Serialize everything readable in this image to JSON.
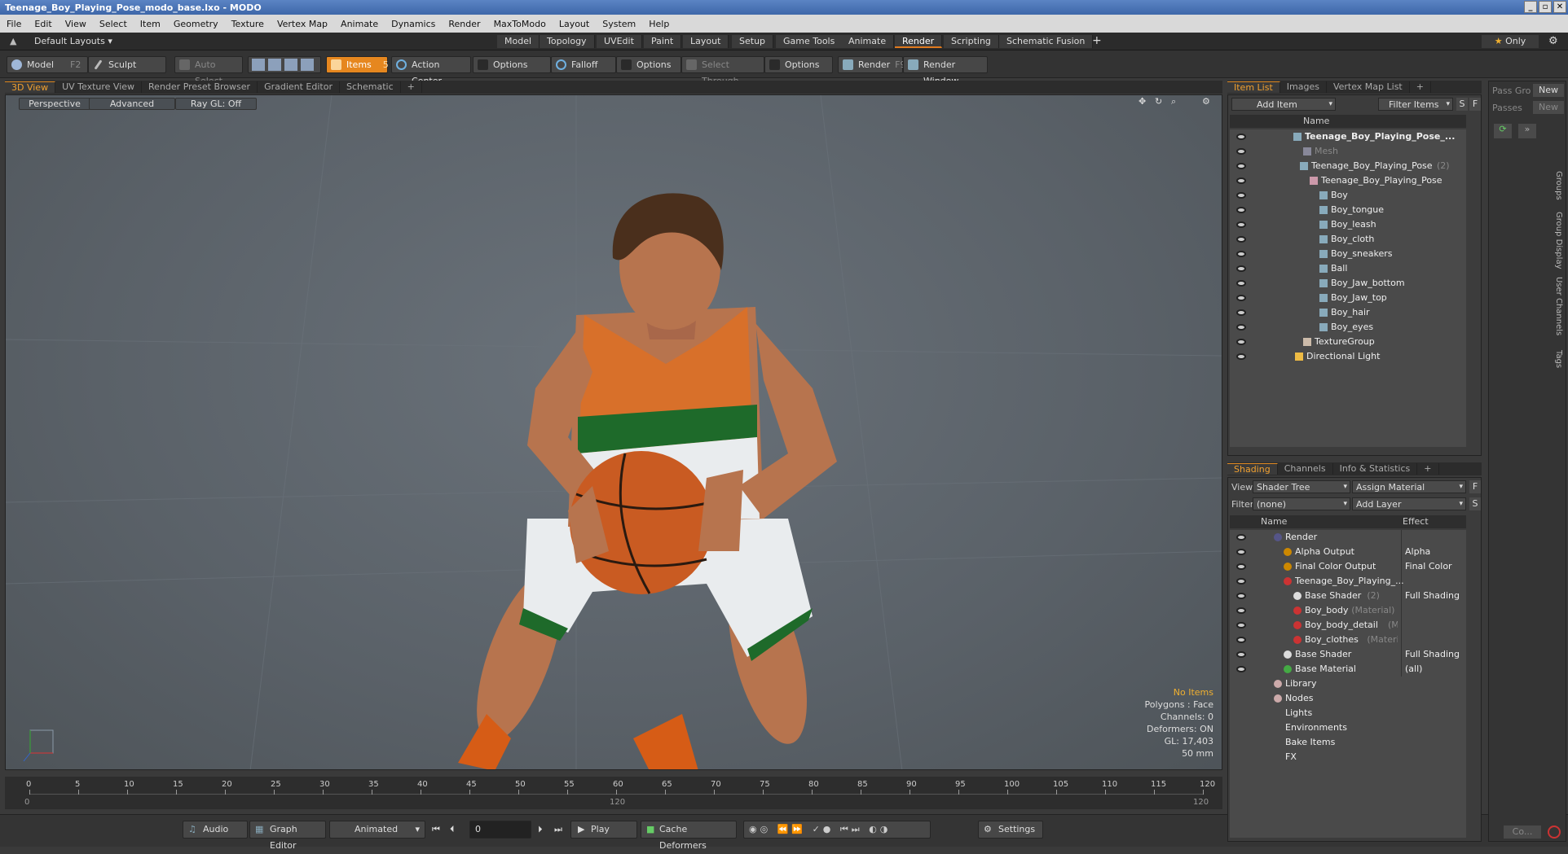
{
  "window": {
    "title": "Teenage_Boy_Playing_Pose_modo_base.lxo - MODO"
  },
  "menu": [
    "File",
    "Edit",
    "View",
    "Select",
    "Item",
    "Geometry",
    "Texture",
    "Vertex Map",
    "Animate",
    "Dynamics",
    "Render",
    "MaxToModo",
    "Layout",
    "System",
    "Help"
  ],
  "layout": {
    "default_layouts": "Default Layouts",
    "tabs": [
      "Model",
      "Topology",
      "UVEdit",
      "Paint",
      "Layout",
      "Setup",
      "Game Tools",
      "Animate",
      "Render",
      "Scripting",
      "Schematic Fusion"
    ],
    "active_tab": "Render",
    "plus": "+",
    "only": "Only"
  },
  "toolbar": {
    "model": "Model",
    "model_key": "F2",
    "sculpt": "Sculpt",
    "auto_select": "Auto Select",
    "items": "Items",
    "items_key": "5",
    "action_center": "Action Center",
    "options1": "Options",
    "falloff": "Falloff",
    "options2": "Options",
    "select_through": "Select Through",
    "options3": "Options",
    "render": "Render",
    "render_key": "F9",
    "render_window": "Render Window"
  },
  "viewport": {
    "tabs": [
      "3D View",
      "UV Texture View",
      "Render Preset Browser",
      "Gradient Editor",
      "Schematic"
    ],
    "plus": "+",
    "buttons": [
      "Perspective",
      "Advanced",
      "Ray GL: Off"
    ],
    "info": {
      "no_items": "No Items",
      "polygons": "Polygons : Face",
      "channels": "Channels: 0",
      "deformers": "Deformers: ON",
      "gl": "GL: 17,403",
      "lens": "50 mm"
    }
  },
  "timeline": {
    "ticks": [
      "0",
      "5",
      "10",
      "15",
      "20",
      "25",
      "30",
      "35",
      "40",
      "45",
      "50",
      "55",
      "60",
      "65",
      "70",
      "75",
      "80",
      "85",
      "90",
      "95",
      "100",
      "105",
      "110",
      "115",
      "120"
    ],
    "start": "0",
    "mid": "120",
    "end": "120"
  },
  "transport": {
    "audio": "Audio",
    "graph_editor": "Graph Editor",
    "animated": "Animated",
    "frame": "0",
    "play": "Play",
    "cache_deformers": "Cache Deformers",
    "settings": "Settings"
  },
  "item_list": {
    "tabs": [
      "Item List",
      "Images",
      "Vertex Map List"
    ],
    "plus": "+",
    "add_item": "Add Item",
    "filter_items": "Filter Items",
    "s": "S",
    "f": "F",
    "name_header": "Name",
    "rows": [
      {
        "label": "Teenage_Boy_Playing_Pose_...",
        "note": ""
      },
      {
        "label": "Mesh",
        "note": ""
      },
      {
        "label": "Teenage_Boy_Playing_Pose",
        "note": "(2)"
      },
      {
        "label": "Teenage_Boy_Playing_Pose",
        "note": ""
      },
      {
        "label": "Boy",
        "note": ""
      },
      {
        "label": "Boy_tongue",
        "note": ""
      },
      {
        "label": "Boy_leash",
        "note": ""
      },
      {
        "label": "Boy_cloth",
        "note": ""
      },
      {
        "label": "Boy_sneakers",
        "note": ""
      },
      {
        "label": "Ball",
        "note": ""
      },
      {
        "label": "Boy_Jaw_bottom",
        "note": ""
      },
      {
        "label": "Boy_Jaw_top",
        "note": ""
      },
      {
        "label": "Boy_hair",
        "note": ""
      },
      {
        "label": "Boy_eyes",
        "note": ""
      },
      {
        "label": "TextureGroup",
        "note": ""
      },
      {
        "label": "Directional Light",
        "note": ""
      }
    ]
  },
  "shading": {
    "tabs": [
      "Shading",
      "Channels",
      "Info & Statistics"
    ],
    "plus": "+",
    "view_label": "View",
    "view_value": "Shader Tree",
    "assign_material": "Assign Material",
    "filter_label": "Filter",
    "filter_value": "(none)",
    "add_layer": "Add Layer",
    "f": "F",
    "s": "S",
    "name_header": "Name",
    "effect_header": "Effect",
    "rows": [
      {
        "label": "Render",
        "note": "",
        "effect": ""
      },
      {
        "label": "Alpha Output",
        "note": "",
        "effect": "Alpha"
      },
      {
        "label": "Final Color Output",
        "note": "",
        "effect": "Final Color"
      },
      {
        "label": "Teenage_Boy_Playing_...",
        "note": "",
        "effect": ""
      },
      {
        "label": "Base Shader",
        "note": "(2)",
        "effect": "Full Shading"
      },
      {
        "label": "Boy_body",
        "note": "(Material)",
        "effect": ""
      },
      {
        "label": "Boy_body_detail",
        "note": "(Ma...",
        "effect": ""
      },
      {
        "label": "Boy_clothes",
        "note": "(Material)",
        "effect": ""
      },
      {
        "label": "Base Shader",
        "note": "",
        "effect": "Full Shading"
      },
      {
        "label": "Base Material",
        "note": "",
        "effect": "(all)"
      },
      {
        "label": "Library",
        "note": "",
        "effect": ""
      },
      {
        "label": "Nodes",
        "note": "",
        "effect": ""
      },
      {
        "label": "Lights",
        "note": "",
        "effect": ""
      },
      {
        "label": "Environments",
        "note": "",
        "effect": ""
      },
      {
        "label": "Bake Items",
        "note": "",
        "effect": ""
      },
      {
        "label": "FX",
        "note": "",
        "effect": ""
      }
    ]
  },
  "pass_panel": {
    "pass_group": "Pass Gro",
    "passes": "Passes",
    "new1": "New",
    "new2": "New",
    "vtabs": [
      "Groups",
      "Group Display",
      "User Channels",
      "Tags"
    ],
    "bottom_btn": "Co..."
  }
}
